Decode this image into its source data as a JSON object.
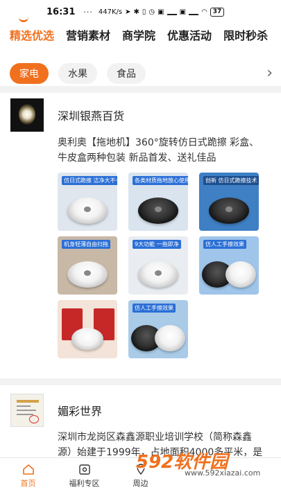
{
  "status_bar": {
    "time": "16:31",
    "dots": "···",
    "speed": "447K/s",
    "battery": "37"
  },
  "top_tabs": [
    "精选优选",
    "营销素材",
    "商学院",
    "优惠活动",
    "限时秒杀"
  ],
  "chips": [
    "家电",
    "水果",
    "食品"
  ],
  "stores": [
    {
      "name": "深圳银燕百货",
      "description": "奥利奥【拖地机】360°旋转仿日式跪擦 彩盒、牛皮盒两种包装 新品首发、送礼佳品",
      "thumbs": [
        {
          "label": "仿日式跪擦 洁净大不一样",
          "bg": "#dfe6ee",
          "band": "#2b6fd6",
          "style": "white"
        },
        {
          "label": "各类材质拖地放心使用",
          "bg": "#d9e4ef",
          "band": "#2b6fd6",
          "style": "dark"
        },
        {
          "label": "创新 仿日式跪擦技术",
          "bg": "#3f7fc4",
          "band": "#1d4f8f",
          "style": "dark"
        },
        {
          "label": "机身轻薄自由扫拖",
          "bg": "#c8b8a6",
          "band": "#2b6fd6",
          "style": "white"
        },
        {
          "label": "9大功能 一拖即净",
          "bg": "#e9edf2",
          "band": "#2b6fd6",
          "style": "white"
        },
        {
          "label": "仿人工手擦效果",
          "bg": "#9fc5ea",
          "band": "#2b6fd6",
          "style": "mixed"
        },
        {
          "label": "",
          "bg": "#f3e3d8",
          "band": "#d33",
          "style": "red"
        },
        {
          "label": "仿人工手擦效果",
          "bg": "#a9cbe8",
          "band": "#2b6fd6",
          "style": "mixed"
        }
      ]
    },
    {
      "name": "媚彩世界",
      "description": "深圳市龙岗区森鑫源职业培训学校（简称森鑫源）始建于1999年，占地面积4000多平米，是国"
    }
  ],
  "bottom_nav": [
    {
      "label": "首页",
      "icon": "home-icon"
    },
    {
      "label": "福利专区",
      "icon": "gift-icon"
    },
    {
      "label": "周边",
      "icon": "location-icon"
    }
  ],
  "watermark": {
    "big": "592软件园",
    "small": "www.592xiazai.com"
  }
}
